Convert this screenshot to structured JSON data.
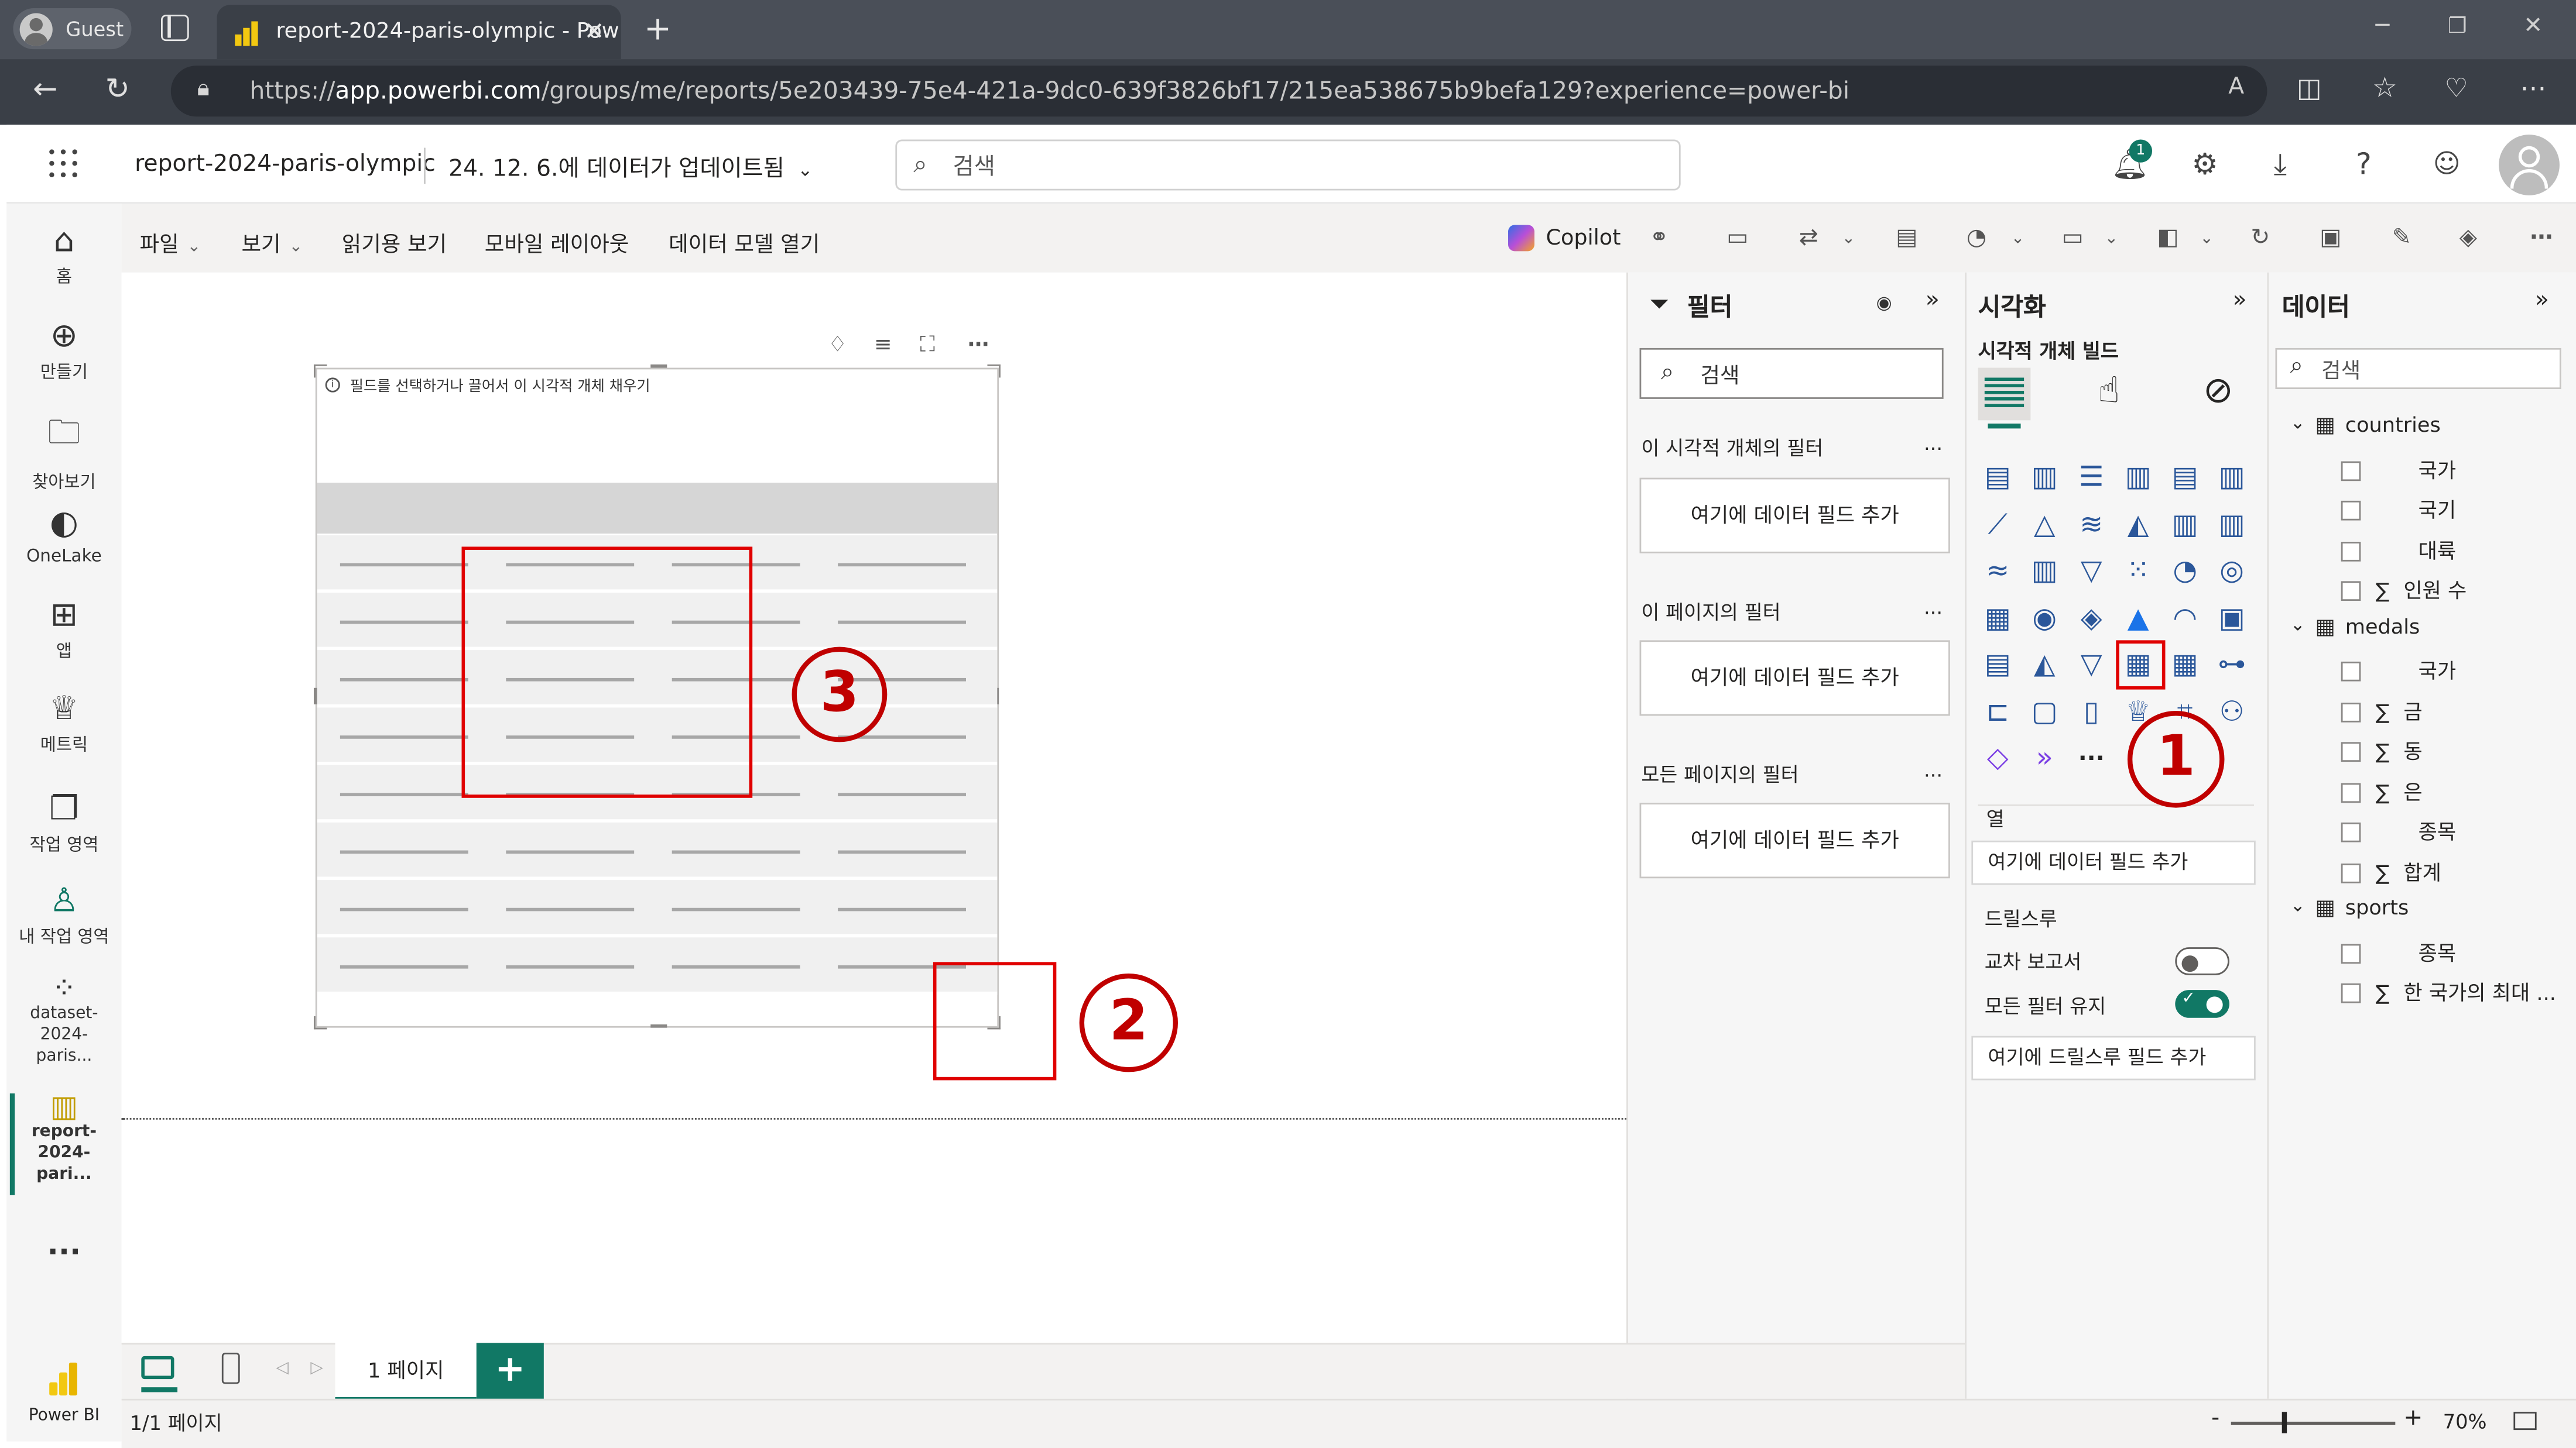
{
  "browser": {
    "profile_label": "Guest",
    "tab_title": "report-2024-paris-olympic - Pow",
    "url_scheme": "https://",
    "url_host": "app.powerbi.com",
    "url_path": "/groups/me/reports/5e203439-75e4-421a-9dc0-639f3826bf17/215ea538675b9befa129?experience=power-bi"
  },
  "header": {
    "report_name": "report-2024-paris-olympic",
    "updated_text": "24. 12. 6.에 데이터가 업데이트됨",
    "search_placeholder": "검색",
    "notification_count": "1"
  },
  "leftnav": {
    "items": [
      {
        "label": "홈"
      },
      {
        "label": "만들기"
      },
      {
        "label": "찾아보기"
      },
      {
        "label": "OneLake"
      },
      {
        "label": "앱"
      },
      {
        "label": "메트릭"
      },
      {
        "label": "작업 영역"
      },
      {
        "label": "내 작업 영역"
      },
      {
        "label": "dataset-2024-paris..."
      },
      {
        "label": "report-2024-pari..."
      }
    ],
    "more_label": "...",
    "brand_label": "Power BI"
  },
  "menubar": {
    "items": [
      "파일",
      "보기",
      "읽기용 보기",
      "모바일 레이아웃",
      "데이터 모델 열기"
    ],
    "copilot_label": "Copilot"
  },
  "canvas": {
    "visual_hint": "필드를 선택하거나 끌어서 이 시각적 개체 채우기",
    "annotations": [
      "1",
      "2",
      "3"
    ]
  },
  "filters": {
    "title": "필터",
    "search_placeholder": "검색",
    "sections": [
      {
        "title": "이 시각적 개체의 필터",
        "drop_label": "여기에 데이터 필드 추가"
      },
      {
        "title": "이 페이지의 필터",
        "drop_label": "여기에 데이터 필드 추가"
      },
      {
        "title": "모든 페이지의 필터",
        "drop_label": "여기에 데이터 필드 추가"
      }
    ],
    "more": "..."
  },
  "viz": {
    "title": "시각화",
    "subtitle": "시각적 개체 빌드",
    "columns_label": "열",
    "columns_drop": "여기에 데이터 필드 추가",
    "drillthrough_label": "드릴스루",
    "cross_report_label": "교차 보고서",
    "cross_report_on": false,
    "keep_filters_label": "모든 필터 유지",
    "keep_filters_on": true,
    "drillthrough_drop": "여기에 드릴스루 필드 추가",
    "more_icon": "...",
    "selected_icon": "table-visual-icon"
  },
  "data": {
    "title": "데이터",
    "search_placeholder": "검색",
    "tables": [
      {
        "name": "countries",
        "fields": [
          {
            "name": "국가",
            "sigma": false
          },
          {
            "name": "국기",
            "sigma": false
          },
          {
            "name": "대륙",
            "sigma": false
          },
          {
            "name": "인원 수",
            "sigma": true
          }
        ]
      },
      {
        "name": "medals",
        "fields": [
          {
            "name": "국가",
            "sigma": false
          },
          {
            "name": "금",
            "sigma": true
          },
          {
            "name": "동",
            "sigma": true
          },
          {
            "name": "은",
            "sigma": true
          },
          {
            "name": "종목",
            "sigma": false
          },
          {
            "name": "합계",
            "sigma": true
          }
        ]
      },
      {
        "name": "sports",
        "fields": [
          {
            "name": "종목",
            "sigma": false
          },
          {
            "name": "한 국가의 최대 ...",
            "sigma": true
          }
        ]
      }
    ],
    "sigma": "∑"
  },
  "pages": {
    "tab_label": "1 페이지",
    "add_label": "+",
    "status": "1/1 페이지",
    "zoom": "70%",
    "zoom_minus": "-",
    "zoom_plus": "+"
  },
  "colors": {
    "accent": "#117865",
    "annotation_red": "#c00000",
    "powerbi_yellow": "#f2c811"
  }
}
